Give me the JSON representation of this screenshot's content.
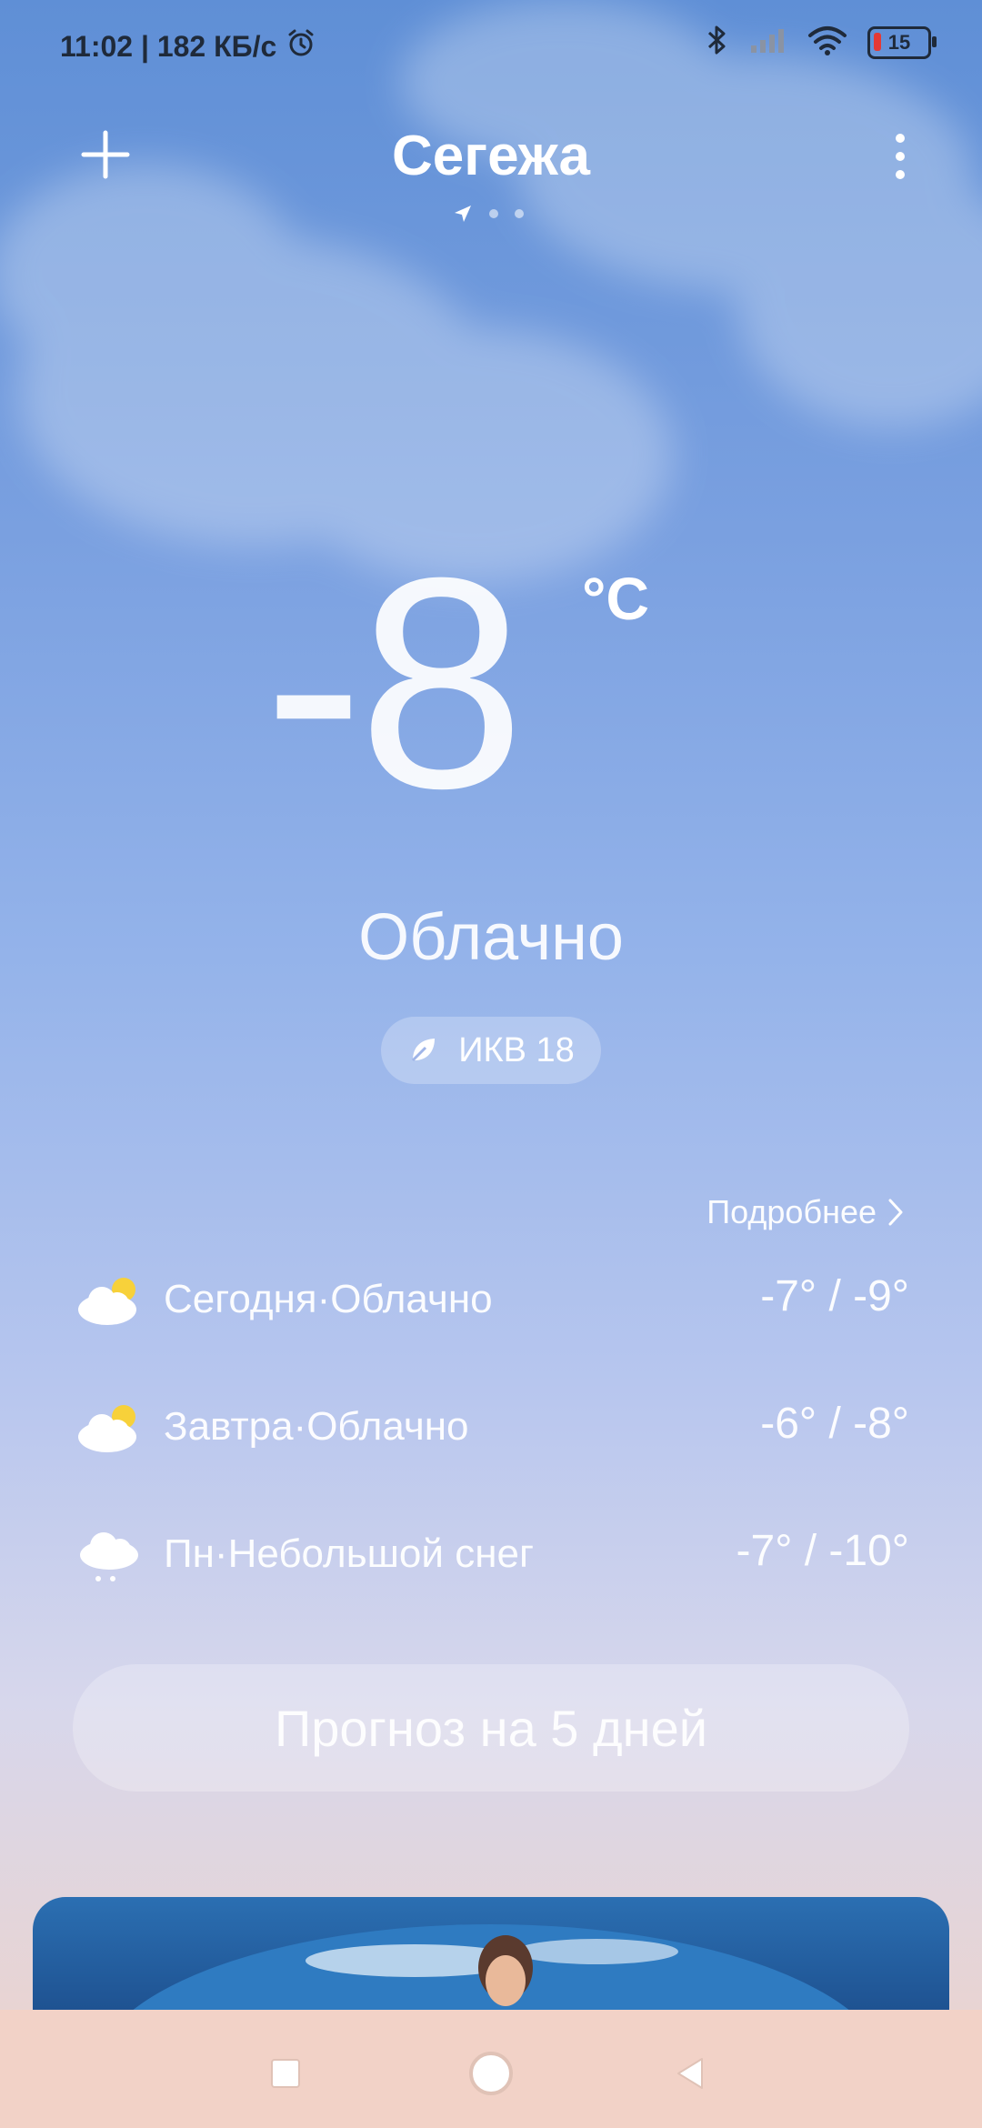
{
  "status": {
    "time_speed": "11:02 | 182 КБ/с",
    "battery": "15"
  },
  "header": {
    "city": "Сегежа"
  },
  "current": {
    "temperature": "-8",
    "unit": "°C",
    "condition": "Облачно",
    "aqi": "ИКВ 18"
  },
  "details_link": "Подробнее",
  "forecast": [
    {
      "label": "Сегодня·Облачно",
      "temps": "-7° / -9°",
      "icon": "partly-cloudy-icon"
    },
    {
      "label": "Завтра·Облачно",
      "temps": "-6° / -8°",
      "icon": "partly-cloudy-icon"
    },
    {
      "label": "Пн·Небольшой снег",
      "temps": "-7° / -10°",
      "icon": "light-snow-icon"
    }
  ],
  "five_day_button": "Прогноз на 5 дней",
  "colors": {
    "accent_sun": "#f7d13a",
    "battery_low": "#e53935"
  }
}
